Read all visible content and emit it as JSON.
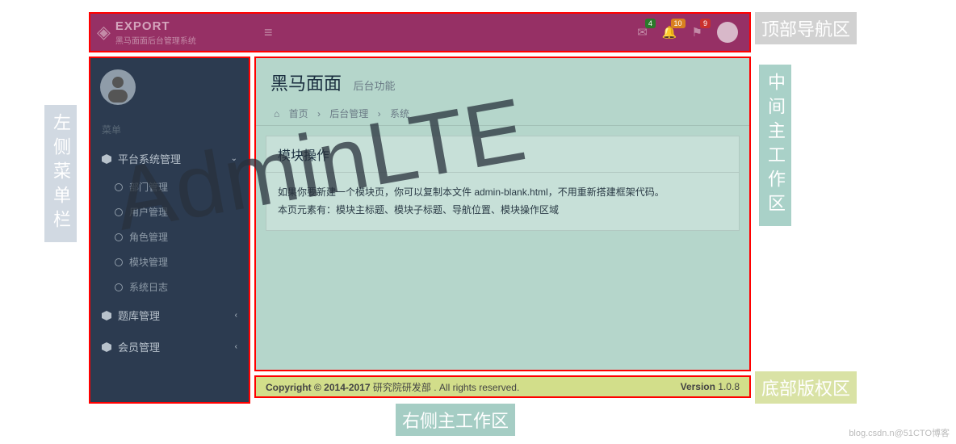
{
  "watermark": "AdminLTE",
  "header": {
    "logo_title": "EXPORT",
    "logo_subtitle": "黑马面面后台管理系统",
    "badges": {
      "mail": "4",
      "bell": "10",
      "flag": "9"
    }
  },
  "sidebar": {
    "menu_header": "菜单",
    "groups": [
      {
        "label": "平台系统管理",
        "expanded": true,
        "chev": "⌄",
        "items": [
          {
            "label": "部门管理"
          },
          {
            "label": "用户管理"
          },
          {
            "label": "角色管理"
          },
          {
            "label": "模块管理"
          },
          {
            "label": "系统日志"
          }
        ]
      },
      {
        "label": "题库管理",
        "expanded": false,
        "chev": "‹"
      },
      {
        "label": "会员管理",
        "expanded": false,
        "chev": "‹"
      }
    ]
  },
  "content": {
    "title": "黑马面面",
    "subtitle": "后台功能",
    "breadcrumb": {
      "home": "首页",
      "sep": "›",
      "mid": "后台管理",
      "last": "系统"
    },
    "panel_title": "模块操作",
    "panel_body_l1": "如果你要新建一个模块页，你可以复制本文件 admin-blank.html，不用重新搭建框架代码。",
    "panel_body_l2": "本页元素有：模块主标题、模块子标题、导航位置、模块操作区域"
  },
  "footer": {
    "copy_strong": "Copyright © 2014-2017 ",
    "org": "研究院研发部",
    "tail": ". All rights reserved.",
    "ver_label": "Version ",
    "ver_value": "1.0.8"
  },
  "annotations": {
    "top": "顶部导航区",
    "left": "左侧菜单栏",
    "right": "中间主工作区",
    "bottom_right": "底部版权区",
    "bottom_main": "右侧主工作区"
  },
  "attribution": "blog.csdn.n@51CTO博客"
}
